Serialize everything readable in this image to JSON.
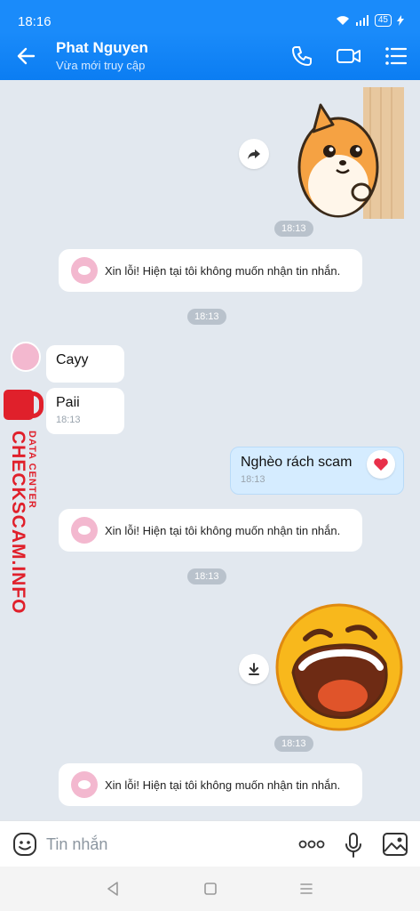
{
  "status_bar": {
    "time": "18:16",
    "battery": "45"
  },
  "header": {
    "name": "Phat Nguyen",
    "status": "Vừa mới truy cập"
  },
  "messages": {
    "time_1": "18:13",
    "system_1": "Xin lỗi! Hiện tại tôi không muốn nhận tin nhắn.",
    "time_2": "18:13",
    "recv_1": {
      "text": "Cayy"
    },
    "recv_2": {
      "text": "Paii",
      "time": "18:13"
    },
    "sent_1": {
      "text": "Nghèo rách scam",
      "time": "18:13",
      "reaction": "heart"
    },
    "system_2": "Xin lỗi! Hiện tại tôi không muốn nhận tin nhắn.",
    "time_3": "18:13",
    "time_4": "18:13",
    "system_3": "Xin lỗi! Hiện tại tôi không muốn nhận tin nhắn."
  },
  "watermark": {
    "main": "CHECKSCAM.INFO",
    "sub": "DATA CENTER"
  },
  "input": {
    "placeholder": "Tin nhắn"
  },
  "colors": {
    "header": "#1a8bfa",
    "sent_bubble": "#d5ecff",
    "chat_bg": "#e2e8ef",
    "watermark": "#e0202b"
  },
  "icons": [
    "back-arrow-icon",
    "phone-icon",
    "video-call-icon",
    "menu-icon",
    "forward-icon",
    "download-icon",
    "emoji-icon",
    "more-icon",
    "mic-icon",
    "image-icon"
  ]
}
